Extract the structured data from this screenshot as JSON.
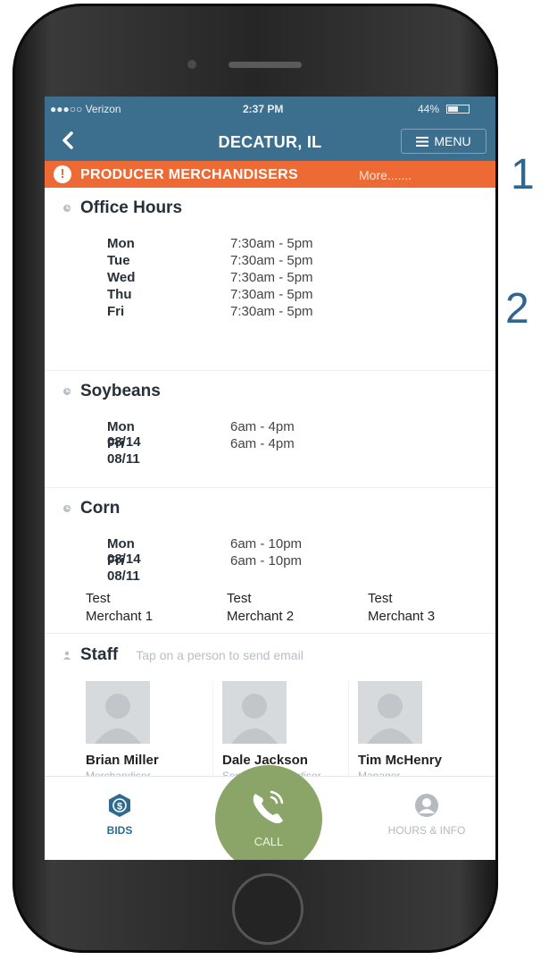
{
  "status_bar": {
    "carrier": "●●●○○ Verizon",
    "time": "2:37 PM",
    "battery": "44%"
  },
  "nav": {
    "title": "DECATUR, IL",
    "menu_label": "MENU"
  },
  "alert": {
    "text": "PRODUCER MERCHANDISERS",
    "more": "More......."
  },
  "office_hours": {
    "title": "Office Hours",
    "rows": [
      {
        "day": "Mon",
        "time": "7:30am - 5pm"
      },
      {
        "day": "Tue",
        "time": "7:30am - 5pm"
      },
      {
        "day": "Wed",
        "time": "7:30am - 5pm"
      },
      {
        "day": "Thu",
        "time": "7:30am - 5pm"
      },
      {
        "day": "Fri",
        "time": "7:30am - 5pm"
      }
    ]
  },
  "soybeans": {
    "title": "Soybeans",
    "rows": [
      {
        "day": "Mon 08/14",
        "time": "6am - 4pm"
      },
      {
        "day": "Fri 08/11",
        "time": "6am - 4pm"
      }
    ]
  },
  "corn": {
    "title": "Corn",
    "rows": [
      {
        "day": "Mon 08/14",
        "time": "6am - 10pm"
      },
      {
        "day": "Fri 08/11",
        "time": "6am - 10pm"
      }
    ]
  },
  "merchants": [
    {
      "label": "Test\nMerchant 1"
    },
    {
      "label": "Test\nMerchant 2"
    },
    {
      "label": "Test\nMerchant 3"
    }
  ],
  "staff": {
    "title": "Staff",
    "hint": "Tap on a person to send email",
    "people": [
      {
        "name": "Brian Miller",
        "role": "Merchandiser"
      },
      {
        "name": "Dale Jackson",
        "role": "Senior Merchandiser"
      },
      {
        "name": "Tim McHenry",
        "role": "Manager"
      }
    ]
  },
  "tabs": {
    "bids": "BIDS",
    "call": "CALL",
    "hours_info": "HOURS & INFO"
  },
  "side_numbers": [
    "1",
    "2"
  ],
  "colors": {
    "header": "#3c6e8e",
    "alert": "#ee6a34",
    "call": "#8aa567",
    "bids_icon": "#2f6a8f",
    "side_numbers": "#2f6690"
  }
}
